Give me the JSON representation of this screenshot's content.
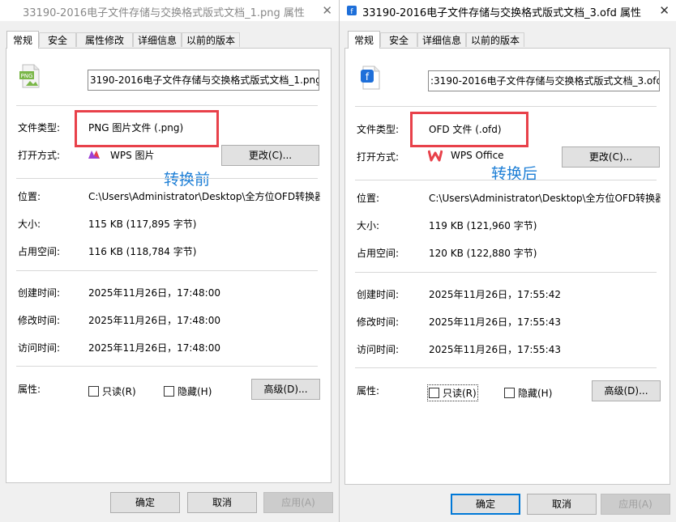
{
  "left": {
    "title": "33190-2016电子文件存储与交换格式版式文档_1.png 属性",
    "tabs": [
      "常规",
      "安全",
      "属性修改",
      "详细信息",
      "以前的版本"
    ],
    "filename": "3190-2016电子文件存储与交换格式版式文档_1.png",
    "labels": {
      "file_type": "文件类型:",
      "open_with": "打开方式:",
      "location": "位置:",
      "size": "大小:",
      "size_on_disk": "占用空间:",
      "created": "创建时间:",
      "modified": "修改时间:",
      "accessed": "访问时间:",
      "attributes": "属性:"
    },
    "file_type": "PNG 图片文件 (.png)",
    "open_with_app": "WPS 图片",
    "change_button": "更改(C)...",
    "location": "C:\\Users\\Administrator\\Desktop\\全方位OFD转换器",
    "size": "115 KB (117,895 字节)",
    "size_on_disk": "116 KB (118,784 字节)",
    "created": "2025年11月26日，17:48:00",
    "modified": "2025年11月26日，17:48:00",
    "accessed": "2025年11月26日，17:48:00",
    "readonly": "只读(R)",
    "hidden": "隐藏(H)",
    "advanced_button": "高级(D)...",
    "ok": "确定",
    "cancel": "取消",
    "apply": "应用(A)",
    "annotation": "转换前"
  },
  "right": {
    "title": "33190-2016电子文件存储与交换格式版式文档_3.ofd 属性",
    "tabs": [
      "常规",
      "安全",
      "详细信息",
      "以前的版本"
    ],
    "filename": ":3190-2016电子文件存储与交换格式版式文档_3.ofd",
    "labels": {
      "file_type": "文件类型:",
      "open_with": "打开方式:",
      "location": "位置:",
      "size": "大小:",
      "size_on_disk": "占用空间:",
      "created": "创建时间:",
      "modified": "修改时间:",
      "accessed": "访问时间:",
      "attributes": "属性:"
    },
    "file_type": "OFD 文件 (.ofd)",
    "open_with_app": "WPS Office",
    "change_button": "更改(C)...",
    "location": "C:\\Users\\Administrator\\Desktop\\全方位OFD转换器",
    "size": "119 KB (121,960 字节)",
    "size_on_disk": "120 KB (122,880 字节)",
    "created": "2025年11月26日，17:55:42",
    "modified": "2025年11月26日，17:55:43",
    "accessed": "2025年11月26日，17:55:43",
    "readonly": "只读(R)",
    "hidden": "隐藏(H)",
    "advanced_button": "高级(D)...",
    "ok": "确定",
    "cancel": "取消",
    "apply": "应用(A)",
    "annotation": "转换后"
  },
  "icons": {
    "close": "close-icon",
    "png_file": "png-file-icon",
    "ofd_file": "ofd-file-icon",
    "wps_image": "wps-image-icon",
    "wps_office": "wps-office-icon"
  },
  "colors": {
    "highlight_red": "#e8414a",
    "annotation_blue": "#1e7fd6",
    "focus_blue": "#0078d7"
  }
}
